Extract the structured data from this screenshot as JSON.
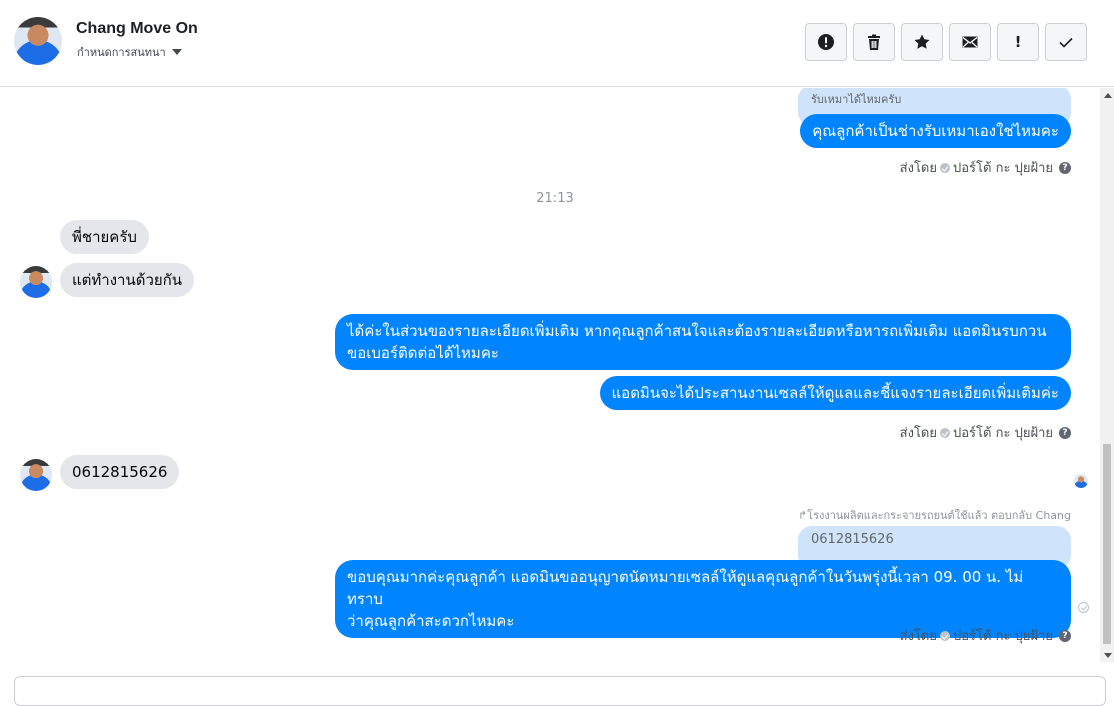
{
  "header": {
    "contact_name": "Chang Move On",
    "assign_label": "กำหนดการสนทนา"
  },
  "toolbar": {
    "buttons": [
      "alert-circle-icon",
      "trash-icon",
      "star-icon",
      "mail-icon",
      "exclamation-icon",
      "check-icon"
    ],
    "exclamation_label": "!"
  },
  "thread": {
    "msg1_quote": "รับเหมาได้ไหมครับ",
    "msg1_text": "คุณลูกค้าเป็นช่างรับเหมาเองใช่ไหมคะ",
    "sent_by_label": "ส่งโดย",
    "sender_name": "ปอร์โต้ กะ ปุยฝ้าย",
    "help_glyph": "?",
    "timestamp": "21:13",
    "in1": "พี่ชายครับ",
    "in2": "แต่ทำงานด้วยกัน",
    "out2_line1": "ได้ค่ะในส่วนของรายละเอียดเพิ่มเติม หากคุณลูกค้าสนใจและต้องรายละเอียดหรือหารถเพิ่มเติม แอดมินรบกวน",
    "out2_line2": "ขอเบอร์ติดต่อได้ไหมคะ",
    "out3": "แอดมินจะได้ประสานงานเซลล์ให้ดูแลและชี้แจงรายละเอียดเพิ่มเติมค่ะ",
    "in3": "0612815626",
    "reply_note": "↱โรงงานผลิตและกระจายรถยนต์ใช้แล้ว ตอบกลับ Chang",
    "reply_quote": "0612815626",
    "out4_line1": "ขอบคุณมากค่ะคุณลูกค้า แอดมินขออนุญาตนัดหมายเซลล์ให้ดูแลคุณลูกค้าในวันพรุ่งนี้เวลา 09. 00 น. ไม่ทราบ",
    "out4_line2": "ว่าคุณลูกค้าสะดวกไหมคะ"
  }
}
